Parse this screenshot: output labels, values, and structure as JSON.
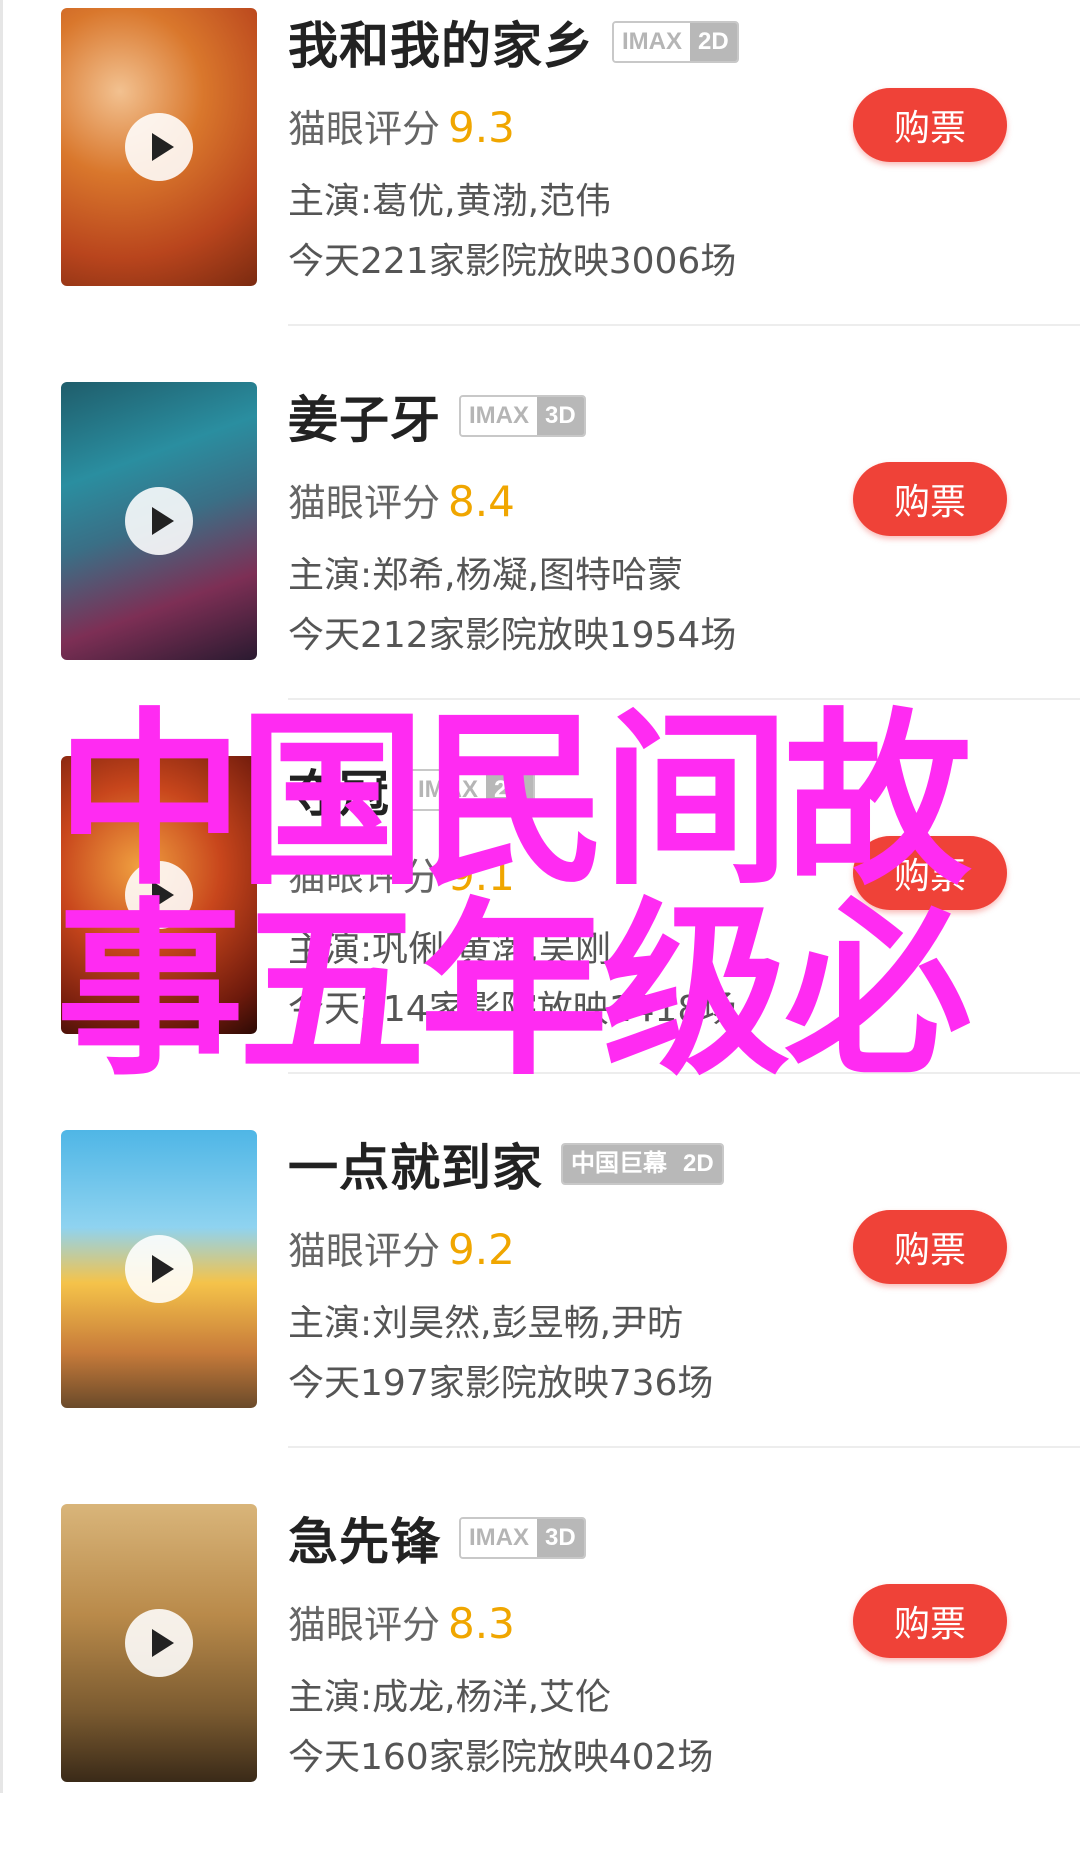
{
  "colors": {
    "accent": "#ef4238",
    "score": "#f0a600",
    "overlay": "#ff2bf2"
  },
  "movies": [
    {
      "title": "我和我的家乡",
      "format": "IMAX",
      "dimension": "2D",
      "score_label": "猫眼评分",
      "score": "9.3",
      "cast": "主演:葛优,黄渤,范伟",
      "showings": "今天221家影院放映3006场",
      "buy_label": "购票"
    },
    {
      "title": "姜子牙",
      "format": "IMAX",
      "dimension": "3D",
      "score_label": "猫眼评分",
      "score": "8.4",
      "cast": "主演:郑希,杨凝,图特哈蒙",
      "showings": "今天212家影院放映1954场",
      "buy_label": "购票"
    },
    {
      "title": "夺冠",
      "format": "IMAX",
      "dimension": "2D",
      "score_label": "猫眼评分",
      "score": "9.1",
      "cast": "主演:巩俐,黄渤,吴刚",
      "showings": "今天214家影院放映1418场",
      "buy_label": "购票"
    },
    {
      "title": "一点就到家",
      "format": "中国巨幕",
      "dimension": "2D",
      "score_label": "猫眼评分",
      "score": "9.2",
      "cast": "主演:刘昊然,彭昱畅,尹昉",
      "showings": "今天197家影院放映736场",
      "buy_label": "购票"
    },
    {
      "title": "急先锋",
      "format": "IMAX",
      "dimension": "3D",
      "score_label": "猫眼评分",
      "score": "8.3",
      "cast": "主演:成龙,杨洋,艾伦",
      "showings": "今天160家影院放映402场",
      "buy_label": "购票"
    }
  ],
  "overlay": {
    "line1": "中国民间故",
    "line2": "事五年级必"
  }
}
